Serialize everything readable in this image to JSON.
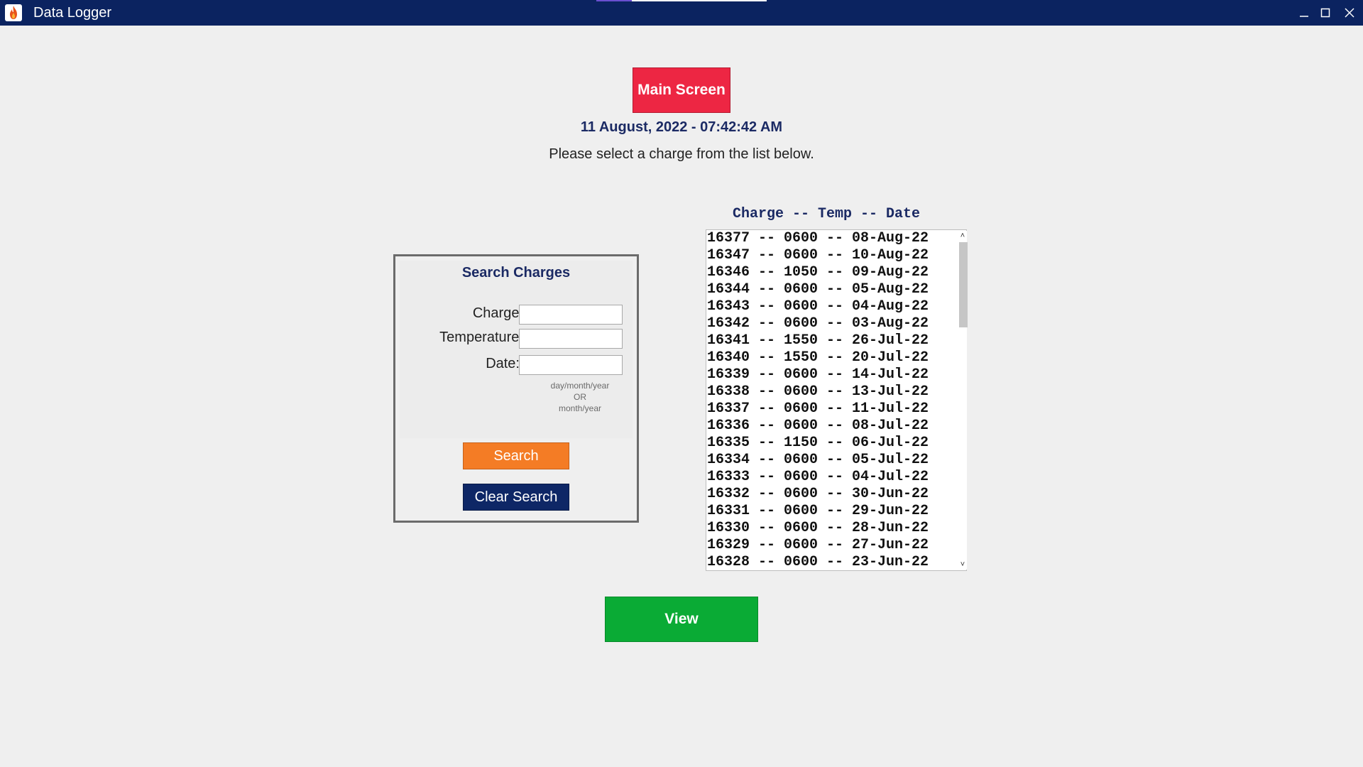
{
  "window": {
    "title": "Data Logger",
    "icons": {
      "app": "flame-icon",
      "minimize": "minimize-icon",
      "maximize": "maximize-icon",
      "close": "close-icon"
    }
  },
  "header": {
    "main_screen_label": "Main Screen",
    "datetime": "11 August, 2022 - 07:42:42 AM",
    "instruction": "Please select a charge from the list below."
  },
  "search": {
    "title": "Search Charges",
    "charge_label": "Charge:",
    "temperature_label": "Temperature:",
    "date_label": "Date:",
    "charge_value": "",
    "temperature_value": "",
    "date_value": "",
    "date_hint_1": "day/month/year",
    "date_hint_2": "OR",
    "date_hint_3": "month/year",
    "search_label": "Search",
    "clear_label": "Clear Search"
  },
  "list": {
    "header": "Charge -- Temp -- Date",
    "items": [
      "16377 -- 0600 -- 08-Aug-22",
      "16347 -- 0600 -- 10-Aug-22",
      "16346 -- 1050 -- 09-Aug-22",
      "16344 -- 0600 -- 05-Aug-22",
      "16343 -- 0600 -- 04-Aug-22",
      "16342 -- 0600 -- 03-Aug-22",
      "16341 -- 1550 -- 26-Jul-22",
      "16340 -- 1550 -- 20-Jul-22",
      "16339 -- 0600 -- 14-Jul-22",
      "16338 -- 0600 -- 13-Jul-22",
      "16337 -- 0600 -- 11-Jul-22",
      "16336 -- 0600 -- 08-Jul-22",
      "16335 -- 1150 -- 06-Jul-22",
      "16334 -- 0600 -- 05-Jul-22",
      "16333 -- 0600 -- 04-Jul-22",
      "16332 -- 0600 -- 30-Jun-22",
      "16331 -- 0600 -- 29-Jun-22",
      "16330 -- 0600 -- 28-Jun-22",
      "16329 -- 0600 -- 27-Jun-22",
      "16328 -- 0600 -- 23-Jun-22"
    ],
    "scroll_up": "˄",
    "scroll_down": "˅"
  },
  "footer": {
    "view_label": "View"
  },
  "colors": {
    "titlebar": "#0b2360",
    "main_screen": "#ed2643",
    "search": "#f47c25",
    "clear": "#0e2766",
    "view": "#0aab35",
    "heading": "#1b2a64"
  }
}
